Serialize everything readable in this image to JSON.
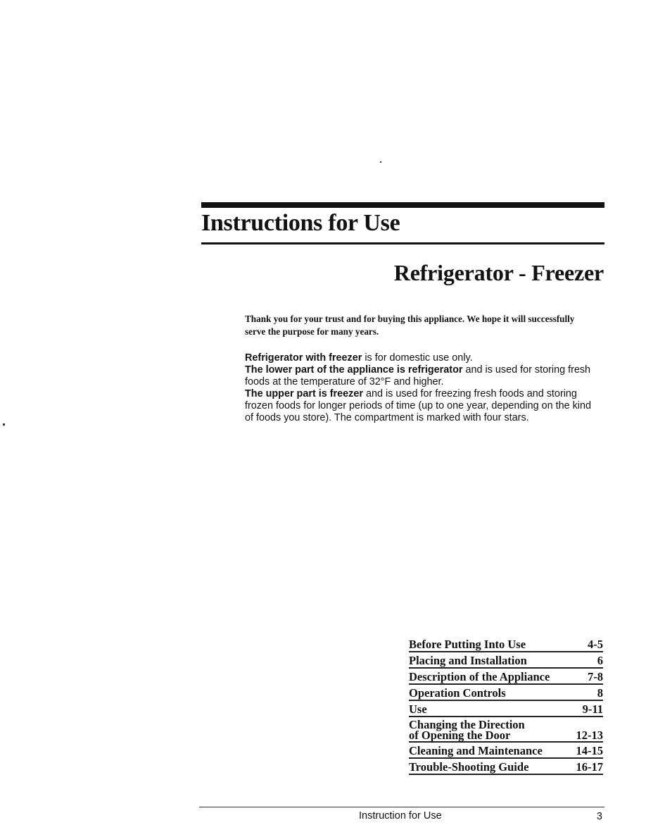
{
  "header": {
    "title": "Instructions for Use",
    "subtitle": "Refrigerator - Freezer"
  },
  "intro": "Thank you for your trust and for buying this appliance. We hope it will successfully serve the purpose for many years.",
  "body": [
    {
      "bold": "Refrigerator with freezer",
      "text": " is for domestic use only."
    },
    {
      "bold": "The lower part of the appliance is refrigerator",
      "text": " and is used for storing fresh foods at the temperature of 32°F and higher."
    },
    {
      "bold": "The upper part is freezer",
      "text": " and is used for freezing fresh foods and storing frozen foods for longer periods of time (up to one year, depending on the kind of foods you store). The compartment is marked with four stars."
    }
  ],
  "toc": [
    {
      "label": "Before Putting Into Use",
      "pages": "4-5"
    },
    {
      "label": "Placing and Installation",
      "pages": "6"
    },
    {
      "label": "Description of the Appliance",
      "pages": "7-8"
    },
    {
      "label": "Operation Controls",
      "pages": "8"
    },
    {
      "label": "Use",
      "pages": "9-11"
    },
    {
      "label": "Changing the Direction\nof Opening the Door",
      "pages": "12-13"
    },
    {
      "label": "Cleaning and Maintenance",
      "pages": "14-15"
    },
    {
      "label": "Trouble-Shooting Guide",
      "pages": "16-17"
    }
  ],
  "footer": {
    "text": "Instruction for Use",
    "page_number": "3"
  }
}
